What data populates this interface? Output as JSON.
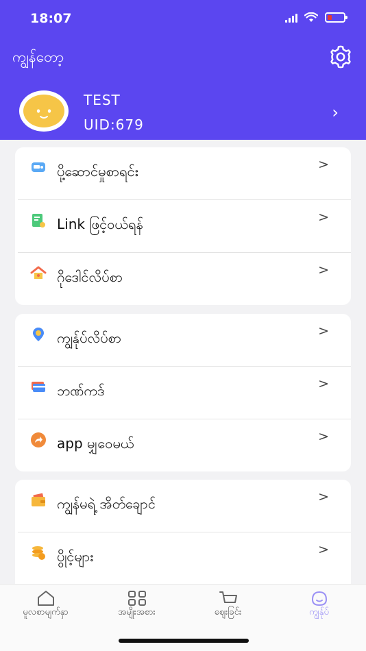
{
  "status": {
    "time": "18:07",
    "battery_level": 0.25
  },
  "header": {
    "title": "ကျွန်တော့",
    "settings_icon": "gear-icon"
  },
  "profile": {
    "name": "TEST",
    "uid": "UID:679"
  },
  "colors": {
    "brand": "#5b46f0",
    "tab_active": "#9a90f5",
    "battery_low": "#e53935"
  },
  "menu_groups": [
    {
      "items": [
        {
          "label": "ပို့ဆောင်မှုစာရင်း",
          "icon": "delivery-truck-icon"
        },
        {
          "label": "Link ဖြင့်ဝယ်ရန်",
          "icon": "link-document-icon"
        },
        {
          "label": "ဂိုဒေါင်လိပ်စာ",
          "icon": "warehouse-icon"
        }
      ]
    },
    {
      "items": [
        {
          "label": "ကျွန်ုပ်လိပ်စာ",
          "icon": "location-pin-icon"
        },
        {
          "label": "ဘဏ်ကဒ်",
          "icon": "bank-card-icon"
        },
        {
          "label": "app မျှဝေမယ်",
          "icon": "share-icon"
        }
      ]
    },
    {
      "items": [
        {
          "label": "ကျွန်မရဲ့ အိတ်ချောင်",
          "icon": "wallet-icon"
        },
        {
          "label": "ပွိုင့်များ",
          "icon": "coins-icon"
        }
      ]
    }
  ],
  "tabbar": {
    "tabs": [
      {
        "label": "မူလစာမျက်နှာ",
        "icon": "home-icon"
      },
      {
        "label": "အမျိုးအစား",
        "icon": "category-grid-icon"
      },
      {
        "label": "ဈေးခြင်း",
        "icon": "shopping-cart-icon"
      },
      {
        "label": "ကျွန်ုပ်",
        "icon": "profile-icon"
      }
    ],
    "active_index": 3
  }
}
